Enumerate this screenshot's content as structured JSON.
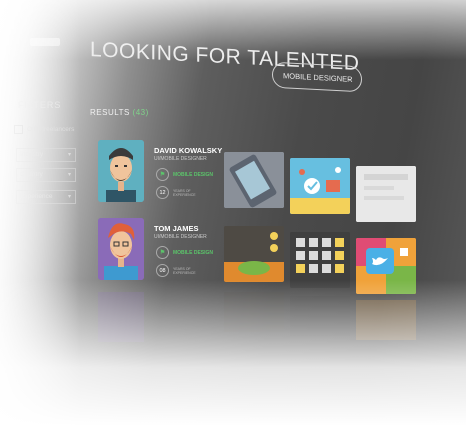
{
  "header": {
    "title": "LOOKING FOR TALENTED",
    "role_select": "MOBILE DESIGNER"
  },
  "sidebar": {
    "title": "FILTERS",
    "checkbox_label": "Only freelancers",
    "selects": [
      "Industry",
      "Country",
      "Experience"
    ]
  },
  "results": {
    "label": "RESULTS",
    "count": "(43)"
  },
  "designers": [
    {
      "name": "DAVID KOWALSKY",
      "title": "UI/MOBILE DESIGNER",
      "skill": "MOBILE DESIGN",
      "years": "12",
      "years_label": "YEARS OF EXPERIENCE"
    },
    {
      "name": "TOM JAMES",
      "title": "UI/MOBILE DESIGNER",
      "skill": "MOBILE DESIGN",
      "years": "08",
      "years_label": "YEARS OF EXPERIENCE"
    }
  ],
  "icons": {
    "flag": "flag-icon",
    "chevron": "chevron-down-icon",
    "twitter": "twitter-icon",
    "lock": "lock-icon"
  },
  "colors": {
    "accent_green": "#5bc46a",
    "count_green": "#7fd38a"
  }
}
